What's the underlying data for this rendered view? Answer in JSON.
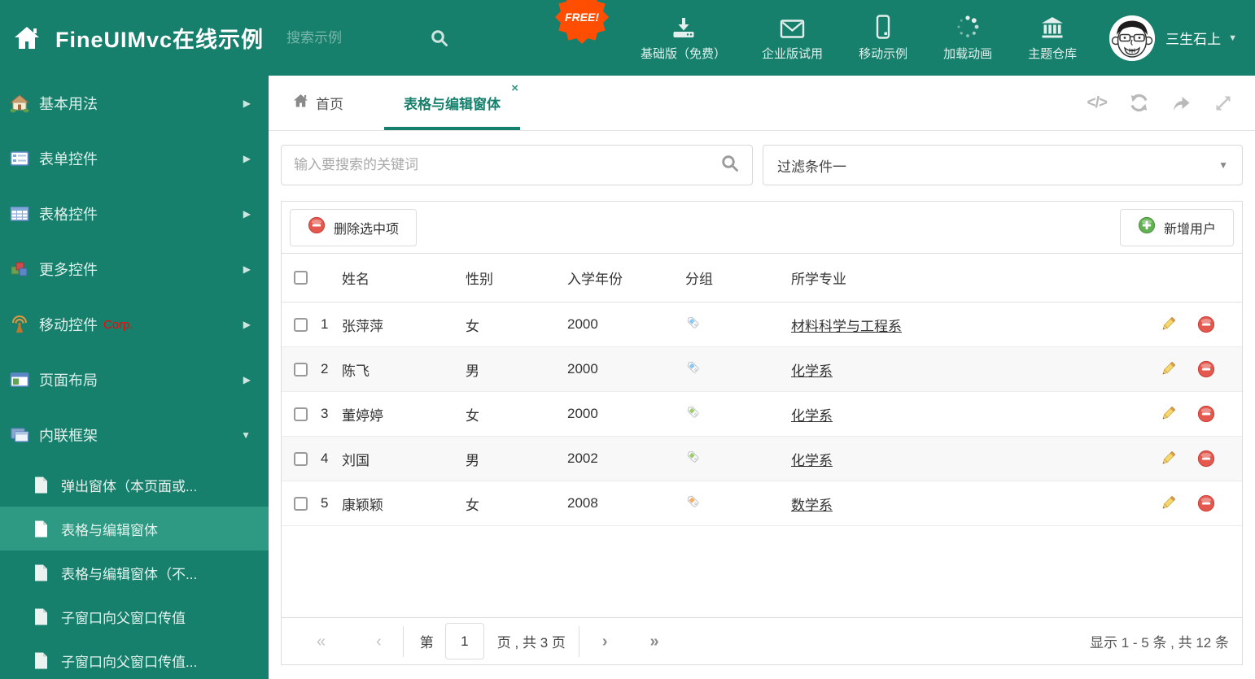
{
  "glyphs": {
    "arrow_right": "▶",
    "arrow_down": "▼",
    "caret_down": "▼",
    "user_caret": "▼",
    "close": "×",
    "code": "</>"
  },
  "colors": {
    "teal": "#17806D",
    "teal_active": "#2F9A83",
    "badge_red": "#FF4E02",
    "corp_red": "#FF0000",
    "tag_blue": "#8CC8F5",
    "tag_green": "#9CCE70",
    "tag_orange": "#F8AC63"
  },
  "header": {
    "title": "FineUIMvc在线示例",
    "search_placeholder": "搜索示例",
    "free_badge": "FREE!",
    "nav": [
      {
        "icon": "download-icon",
        "label": "基础版（免费）"
      },
      {
        "icon": "mail-icon",
        "label": "企业版试用"
      },
      {
        "icon": "mobile-icon",
        "label": "移动示例"
      },
      {
        "icon": "spinner-icon",
        "label": "加载动画"
      },
      {
        "icon": "bank-icon",
        "label": "主题仓库"
      }
    ],
    "user": {
      "name": "三生石上"
    }
  },
  "sidebar": {
    "items": [
      {
        "label": "基本用法",
        "icon": "home-icon"
      },
      {
        "label": "表单控件",
        "icon": "form-icon"
      },
      {
        "label": "表格控件",
        "icon": "table-icon"
      },
      {
        "label": "更多控件",
        "icon": "cubes-icon"
      },
      {
        "label": "移动控件",
        "badge": "Corp.",
        "icon": "antenna-icon"
      },
      {
        "label": "页面布局",
        "icon": "layout-icon"
      },
      {
        "label": "内联框架",
        "icon": "frames-icon",
        "expanded": true
      }
    ],
    "subitems": [
      {
        "label": "弹出窗体（本页面或..."
      },
      {
        "label": "表格与编辑窗体",
        "active": true
      },
      {
        "label": "表格与编辑窗体（不..."
      },
      {
        "label": "子窗口向父窗口传值"
      },
      {
        "label": "子窗口向父窗口传值..."
      }
    ]
  },
  "tabbar": {
    "tabs": [
      {
        "label": "首页",
        "icon": "home-icon"
      },
      {
        "label": "表格与编辑窗体",
        "active": true,
        "closable": true
      }
    ],
    "tools": [
      "code-icon",
      "refresh-icon",
      "share-icon",
      "expand-icon"
    ]
  },
  "filters": {
    "search_placeholder": "输入要搜索的关键词",
    "filter_value": "过滤条件一"
  },
  "toolbar": {
    "delete_label": "删除选中项",
    "add_label": "新增用户"
  },
  "table": {
    "columns": [
      "姓名",
      "性别",
      "入学年份",
      "分组",
      "所学专业"
    ],
    "rows": [
      {
        "num": "1",
        "name": "张萍萍",
        "gender": "女",
        "year": "2000",
        "tag_color": "#8CC8F5",
        "major": "材料科学与工程系"
      },
      {
        "num": "2",
        "name": "陈飞",
        "gender": "男",
        "year": "2000",
        "tag_color": "#8CC8F5",
        "major": "化学系"
      },
      {
        "num": "3",
        "name": "董婷婷",
        "gender": "女",
        "year": "2000",
        "tag_color": "#9CCE70",
        "major": "化学系"
      },
      {
        "num": "4",
        "name": "刘国",
        "gender": "男",
        "year": "2002",
        "tag_color": "#9CCE70",
        "major": "化学系"
      },
      {
        "num": "5",
        "name": "康颖颖",
        "gender": "女",
        "year": "2008",
        "tag_color": "#F8AC63",
        "major": "数学系"
      }
    ]
  },
  "pagination": {
    "first": "«",
    "prev": "‹",
    "page_before": "第",
    "page_value": "1",
    "page_after": "页 , 共 3 页",
    "next": "›",
    "last": "»",
    "summary": "显示 1 - 5 条 , 共 12 条"
  }
}
